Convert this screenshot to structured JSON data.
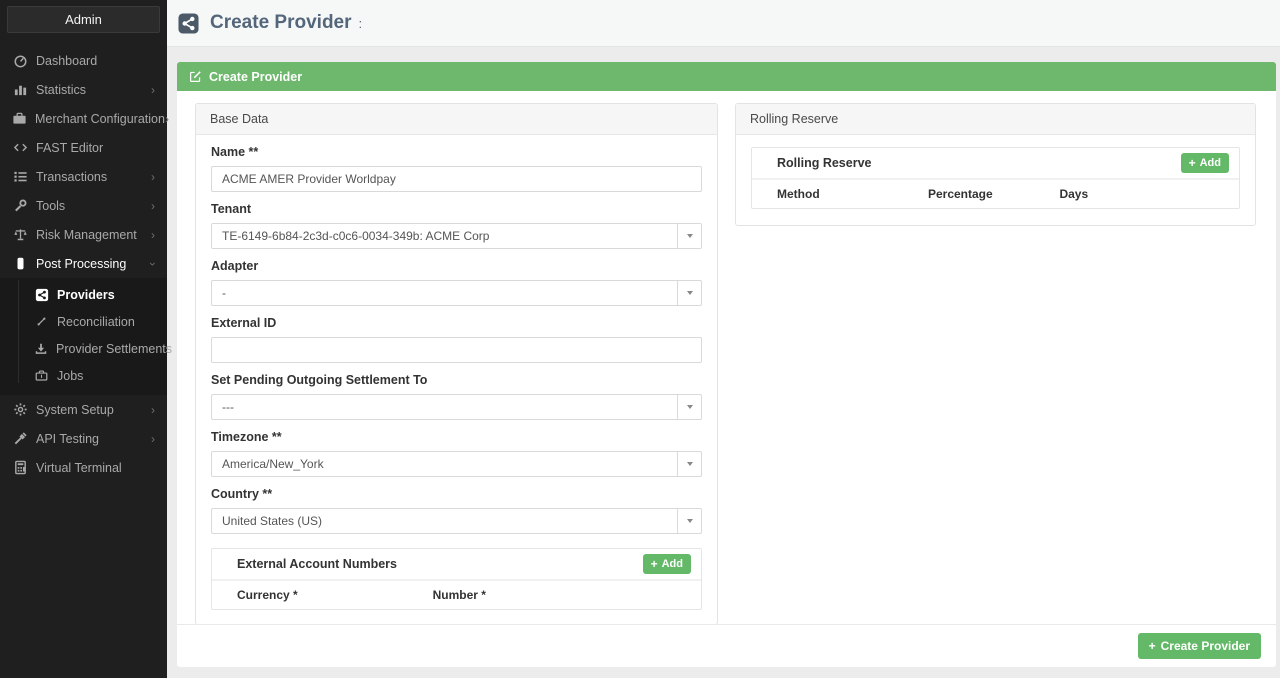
{
  "colors": {
    "accent_green": "#6db86c",
    "button_green": "#64b969",
    "title_slate": "#53667a",
    "sidebar_bg": "#1f1f1f"
  },
  "sidebar": {
    "title": "Admin",
    "items": [
      {
        "label": "Dashboard",
        "icon": "dashboard-icon"
      },
      {
        "label": "Statistics",
        "icon": "statistics-icon",
        "chevron": "right"
      },
      {
        "label": "Merchant Configuration",
        "icon": "merchant-configuration-icon",
        "chevron": "right"
      },
      {
        "label": "FAST Editor",
        "icon": "fast-editor-icon"
      },
      {
        "label": "Transactions",
        "icon": "transactions-icon",
        "chevron": "right"
      },
      {
        "label": "Tools",
        "icon": "tools-icon",
        "chevron": "right"
      },
      {
        "label": "Risk Management",
        "icon": "risk-management-icon",
        "chevron": "right"
      },
      {
        "label": "Post Processing",
        "icon": "post-processing-icon",
        "chevron": "down",
        "expanded": true
      },
      {
        "label": "System Setup",
        "icon": "system-setup-icon",
        "chevron": "right"
      },
      {
        "label": "API Testing",
        "icon": "api-testing-icon",
        "chevron": "right"
      },
      {
        "label": "Virtual Terminal",
        "icon": "virtual-terminal-icon"
      }
    ],
    "post_processing_children": [
      {
        "label": "Providers",
        "icon": "providers-icon",
        "active": true
      },
      {
        "label": "Reconciliation",
        "icon": "reconciliation-icon"
      },
      {
        "label": "Provider Settlements",
        "icon": "provider-settlements-icon"
      },
      {
        "label": "Jobs",
        "icon": "jobs-icon"
      }
    ]
  },
  "header": {
    "title": "Create Provider",
    "suffix": ":"
  },
  "banner": {
    "label": "Create Provider"
  },
  "base_data": {
    "panel_title": "Base Data",
    "name_label": "Name **",
    "name_value": "ACME AMER Provider Worldpay",
    "tenant_label": "Tenant",
    "tenant_value": "TE-6149-6b84-2c3d-c0c6-0034-349b: ACME Corp",
    "adapter_label": "Adapter",
    "adapter_value": "-",
    "external_id_label": "External ID",
    "external_id_value": "",
    "pending_label": "Set Pending Outgoing Settlement To",
    "pending_value": "---",
    "timezone_label": "Timezone **",
    "timezone_value": "America/New_York",
    "country_label": "Country **",
    "country_value": "United States (US)",
    "external_accounts": {
      "title": "External Account Numbers",
      "add_label": "Add",
      "columns": [
        "Currency *",
        "Number *"
      ]
    }
  },
  "rolling_reserve": {
    "panel_title": "Rolling Reserve",
    "table_title": "Rolling Reserve",
    "add_label": "Add",
    "columns": [
      "Method",
      "Percentage",
      "Days"
    ]
  },
  "footer": {
    "create_label": "Create Provider"
  }
}
